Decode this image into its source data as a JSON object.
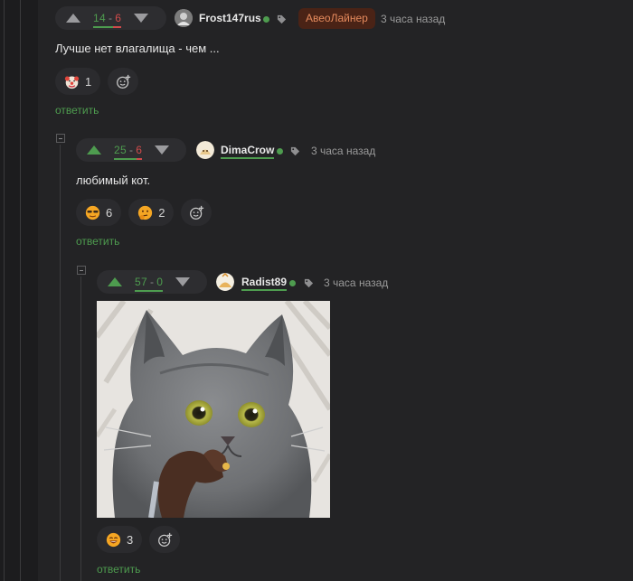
{
  "comments": [
    {
      "pluses": "14",
      "sep": "-",
      "minuses": "6",
      "ratio": 0.7,
      "username": "Frost147rus",
      "badge": "АвеоЛайнер",
      "time": "3 часа назад",
      "text": "Лучше нет влагалища - чем ...",
      "reactions": [
        {
          "icon": "clown-emoji-icon",
          "count": "1"
        }
      ],
      "reply": "ответить"
    },
    {
      "pluses": "25",
      "sep": "-",
      "minuses": "6",
      "ratio": 0.806,
      "username": "DimaCrow",
      "time": "3 часа назад",
      "text": "любимый кот.",
      "reactions": [
        {
          "icon": "sunglasses-emoji-icon",
          "count": "6"
        },
        {
          "icon": "thinking-emoji-icon",
          "count": "2"
        }
      ],
      "reply": "ответить"
    },
    {
      "pluses": "57",
      "sep": "-",
      "minuses": "0",
      "ratio": 1,
      "username": "Radist89",
      "time": "3 часа назад",
      "image": "shocked-gray-cat-photo",
      "reactions": [
        {
          "icon": "laughing-emoji-icon",
          "count": "3"
        }
      ],
      "reply": "ответить"
    }
  ],
  "colors": {
    "plus": "#4e9c4f",
    "minus": "#d14b4b",
    "badge_bg": "#4a2316",
    "badge_text": "#e58a5d",
    "background": "#232325"
  }
}
